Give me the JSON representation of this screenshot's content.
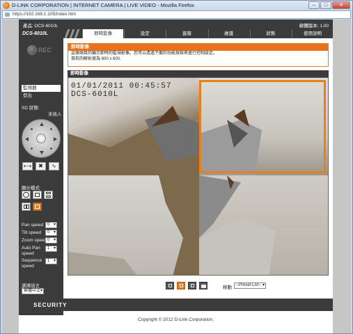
{
  "browser": {
    "title": "D-LINK CORPORATION | INTERNET CAMERA | LIVE VIDEO - Mozilla Firefox",
    "url": "https://192.168.1.105/index.htm",
    "controls": [
      "minimize",
      "maximize",
      "close"
    ]
  },
  "header": {
    "product": "產品: DCS-6010L",
    "firmware": "韌體版本: 1.00",
    "model": "DCS-6010L"
  },
  "nav": {
    "tabs": [
      {
        "label": "即時影像",
        "active": true
      },
      {
        "label": "設定",
        "active": false
      },
      {
        "label": "進階",
        "active": false
      },
      {
        "label": "維護",
        "active": false
      },
      {
        "label": "狀態",
        "active": false
      },
      {
        "label": "使用說明",
        "active": false
      }
    ]
  },
  "sidebar": {
    "logo_text": "REC",
    "items": [
      {
        "label": "監視器",
        "selected": true
      },
      {
        "label": "登出",
        "selected": false
      }
    ],
    "sd_status_label": "SD 狀態:",
    "sd_status_value": "未插入",
    "display_mode_label": "顯示模式",
    "speeds": [
      {
        "label": "Pan speed",
        "value": "0"
      },
      {
        "label": "Tilt speed",
        "value": "0"
      },
      {
        "label": "Zoom speed",
        "value": "0"
      },
      {
        "label": "Auto Pan speed",
        "value": "1"
      },
      {
        "label": "Sequence speed",
        "value": "1"
      }
    ],
    "language_label": "選擇語言",
    "language_value": "繁體中文"
  },
  "info": {
    "title": "即時影像",
    "line1": "這個項目的顯示即時的監視影像。您可以透過下面的功能按鈕來進行控制設定。",
    "line2": "目前的解析度為 800 x 600."
  },
  "video": {
    "title": "即時影像",
    "timestamp": "01/01/2011 00:45:57",
    "camera_label": "DCS-6010L"
  },
  "toolbar": {
    "move_label": "移動",
    "preset_value": "--Preset List--"
  },
  "footer": {
    "brand": "SECURITY",
    "copyright": "Copyright © 2012 D-Link Corporation."
  }
}
